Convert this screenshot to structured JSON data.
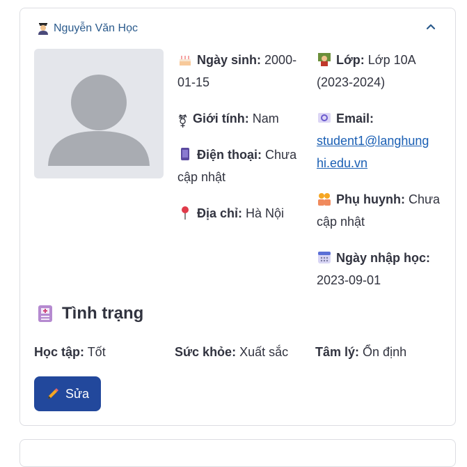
{
  "student": {
    "name": "Nguyễn Văn Học"
  },
  "fields": {
    "dob_label": "Ngày sinh:",
    "dob_value_1": "2000-",
    "dob_value_2": "01-15",
    "gender_label": "Giới tính:",
    "gender_value": "Nam",
    "phone_label": "Điện thoại:",
    "phone_value_1": "Chưa",
    "phone_value_2": "cập nhật",
    "address_label": "Địa chỉ:",
    "address_value": "Hà Nội",
    "class_label": "Lớp:",
    "class_value_1": "Lớp 10A",
    "class_value_2": "(2023-2024)",
    "email_label": "Email:",
    "email_value_1": "student1@langhung",
    "email_value_2": "hi.edu.vn",
    "parent_label": "Phụ huynh:",
    "parent_value_1": "Chưa",
    "parent_value_2": "cập nhật",
    "enroll_label": "Ngày nhập học:",
    "enroll_value": "2023-09-01"
  },
  "status": {
    "title": "Tình trạng",
    "study_label": "Học tập:",
    "study_value": "Tốt",
    "health_label": "Sức khỏe:",
    "health_value": "Xuất sắc",
    "mental_label": "Tâm lý:",
    "mental_value": "Ổn định"
  },
  "actions": {
    "edit_label": "Sửa"
  },
  "icons": {
    "header": "student-icon",
    "collapse": "chevron-up-icon",
    "dob": "birthday-cake-icon",
    "gender": "gender-symbol-icon",
    "phone": "mobile-phone-icon",
    "address": "map-pin-icon",
    "class": "teacher-icon",
    "email": "email-icon",
    "parent": "parents-icon",
    "enroll": "calendar-icon",
    "status": "medical-record-icon",
    "edit": "pencil-icon"
  },
  "colors": {
    "accent": "#22489c",
    "name_link": "#2a5a8c",
    "email_link": "#1a5fb4"
  }
}
